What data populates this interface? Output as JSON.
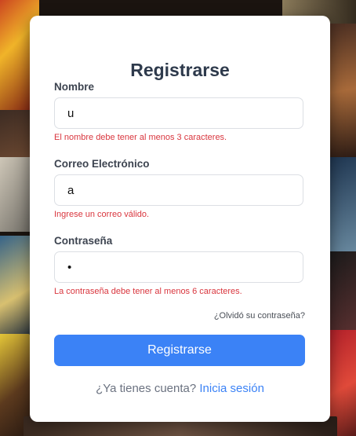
{
  "form": {
    "title": "Registrarse",
    "name_label": "Nombre",
    "name_value": "u",
    "name_error": "El nombre debe tener al menos 3 caracteres.",
    "email_label": "Correo Electrónico",
    "email_value": "a",
    "email_error": "Ingrese un correo válido.",
    "password_label": "Contraseña",
    "password_value": "•",
    "password_error": "La contraseña debe tener al menos 6 caracteres.",
    "forgot_link": "¿Olvidó su contraseña?",
    "submit_label": "Registrarse",
    "footer_text": "¿Ya tienes cuenta?",
    "footer_link": "Inicia sesión"
  },
  "colors": {
    "accent": "#3b82f6",
    "error": "#d9363e",
    "title": "#2e3a4c"
  }
}
